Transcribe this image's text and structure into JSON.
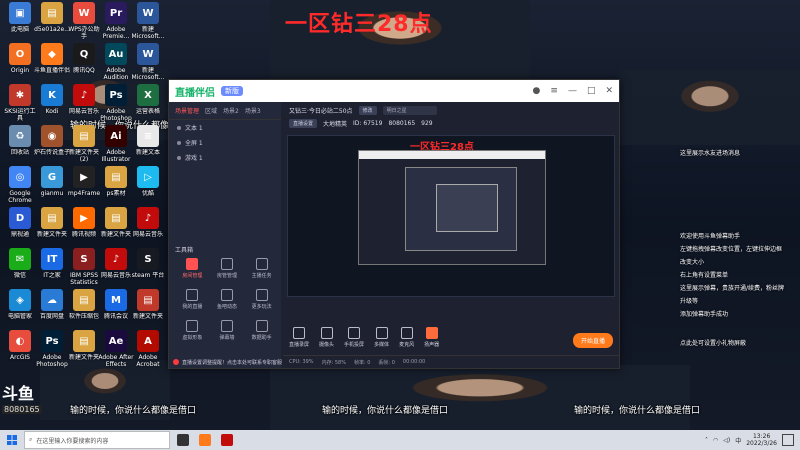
{
  "overlay_title": "一区钻三28点",
  "subtitles": [
    "输的时候，你说什么都像是借口",
    "输的时候，你说什么都像是借口",
    "输的时候，你说什么都像是借口"
  ],
  "desktop_icons": [
    {
      "label": "此电脑",
      "icon": "computer-icon",
      "color": "#3a7bd5",
      "glyph": "▣"
    },
    {
      "label": "d5e01a2e...",
      "icon": "folder-icon",
      "color": "#d9a441",
      "glyph": "▤"
    },
    {
      "label": "WPS办公助手",
      "icon": "wps-icon",
      "color": "#e94b3c",
      "glyph": "W"
    },
    {
      "label": "Adobe Premie...",
      "icon": "premiere-icon",
      "color": "#2a1a5e",
      "glyph": "Pr"
    },
    {
      "label": "新建Microsoft...",
      "icon": "doc-icon",
      "color": "#2b579a",
      "glyph": "W"
    },
    {
      "label": "Origin",
      "icon": "origin-icon",
      "color": "#f36f21",
      "glyph": "O"
    },
    {
      "label": "斗鱼直播伴侣",
      "icon": "douyu-icon",
      "color": "#ff7a1a",
      "glyph": "◆"
    },
    {
      "label": "腾讯QQ",
      "icon": "qq-icon",
      "color": "#1a1a1a",
      "glyph": "Q"
    },
    {
      "label": "Adobe Audition",
      "icon": "audition-icon",
      "color": "#00485a",
      "glyph": "Au"
    },
    {
      "label": "新建Microsoft...",
      "icon": "doc-icon",
      "color": "#2b579a",
      "glyph": "W"
    },
    {
      "label": "SKSI运行工具",
      "icon": "tool-icon",
      "color": "#c0392b",
      "glyph": "✱"
    },
    {
      "label": "Kodi",
      "icon": "kodi-icon",
      "color": "#1a7bd5",
      "glyph": "K"
    },
    {
      "label": "网易云音乐",
      "icon": "music-icon",
      "color": "#c20c0c",
      "glyph": "♪"
    },
    {
      "label": "Adobe Photoshop",
      "icon": "photoshop-icon",
      "color": "#001e36",
      "glyph": "Ps"
    },
    {
      "label": "运营表格",
      "icon": "excel-icon",
      "color": "#1d6f42",
      "glyph": "X"
    },
    {
      "label": "回收站",
      "icon": "recycle-icon",
      "color": "#6a8caf",
      "glyph": "♻"
    },
    {
      "label": "炉石传说盒子",
      "icon": "hearthstone-icon",
      "color": "#a0522d",
      "glyph": "◉"
    },
    {
      "label": "新建文件夹(2)",
      "icon": "folder-icon",
      "color": "#d9a441",
      "glyph": "▤"
    },
    {
      "label": "Adobe Illustrator",
      "icon": "illustrator-icon",
      "color": "#330000",
      "glyph": "Ai"
    },
    {
      "label": "新建文本",
      "icon": "text-icon",
      "color": "#e8e8e8",
      "glyph": "≡"
    },
    {
      "label": "Google Chrome",
      "icon": "chrome-icon",
      "color": "#4285f4",
      "glyph": "◎"
    },
    {
      "label": "gianmu",
      "icon": "app-icon",
      "color": "#3a9ad9",
      "glyph": "G"
    },
    {
      "label": "mp4Frame",
      "icon": "video-icon",
      "color": "#222",
      "glyph": "▶"
    },
    {
      "label": "ps素材",
      "icon": "folder-icon",
      "color": "#d9a441",
      "glyph": "▤"
    },
    {
      "label": "优酷",
      "icon": "youku-icon",
      "color": "#1ebbf0",
      "glyph": "▷"
    },
    {
      "label": "鼎视通",
      "icon": "app-icon",
      "color": "#2a5bd5",
      "glyph": "D"
    },
    {
      "label": "新建文件夹",
      "icon": "folder-icon",
      "color": "#d9a441",
      "glyph": "▤"
    },
    {
      "label": "腾讯视频",
      "icon": "tencent-video-icon",
      "color": "#ff6a00",
      "glyph": "▶"
    },
    {
      "label": "新建文件夹",
      "icon": "folder-icon",
      "color": "#d9a441",
      "glyph": "▤"
    },
    {
      "label": "网易云音乐",
      "icon": "music-icon",
      "color": "#c20c0c",
      "glyph": "♪"
    },
    {
      "label": "微信",
      "icon": "wechat-icon",
      "color": "#1aad19",
      "glyph": "✉"
    },
    {
      "label": "IT之家",
      "icon": "ithome-icon",
      "color": "#1a6ae6",
      "glyph": "IT"
    },
    {
      "label": "IBM SPSS Statistics 26",
      "icon": "spss-icon",
      "color": "#8b1e1e",
      "glyph": "S"
    },
    {
      "label": "网易云音乐",
      "icon": "music-icon",
      "color": "#c20c0c",
      "glyph": "♪"
    },
    {
      "label": "steam 平台",
      "icon": "steam-icon",
      "color": "#171a21",
      "glyph": "S"
    },
    {
      "label": "电脑管家",
      "icon": "security-icon",
      "color": "#1a8ad5",
      "glyph": "◈"
    },
    {
      "label": "百度网盘",
      "icon": "baidu-icon",
      "color": "#2a7bd5",
      "glyph": "☁"
    },
    {
      "label": "软件压缩包",
      "icon": "folder-icon",
      "color": "#d9a441",
      "glyph": "▤"
    },
    {
      "label": "腾讯会议",
      "icon": "meeting-icon",
      "color": "#1a6ae6",
      "glyph": "M"
    },
    {
      "label": "新建文件夹",
      "icon": "folder-icon",
      "color": "#c0392b",
      "glyph": "▤"
    },
    {
      "label": "ArcGIS",
      "icon": "arcgis-icon",
      "color": "#e74c3c",
      "glyph": "◐"
    },
    {
      "label": "Adobe Photoshop",
      "icon": "photoshop-icon",
      "color": "#001e36",
      "glyph": "Ps"
    },
    {
      "label": "新建文件夹",
      "icon": "folder-icon",
      "color": "#d9a441",
      "glyph": "▤"
    },
    {
      "label": "Adobe After Effects",
      "icon": "aftereffects-icon",
      "color": "#1a0a3e",
      "glyph": "Ae"
    },
    {
      "label": "Adobe Acrobat",
      "icon": "acrobat-icon",
      "color": "#b30b00",
      "glyph": "A"
    }
  ],
  "window": {
    "app_name": "直播伴侣",
    "version_badge": "新版",
    "tabs": [
      "场景管理",
      "区域",
      "场景2",
      "场景3"
    ],
    "scenes": [
      "文本 1",
      "全屏 1",
      "游戏 1"
    ],
    "tools_heading": "工具箱",
    "tools": [
      {
        "label": "房间管理",
        "icon": "room-icon",
        "hot": true
      },
      {
        "label": "房管管理",
        "icon": "admin-icon",
        "hot": false
      },
      {
        "label": "主播任务",
        "icon": "task-icon",
        "hot": false
      },
      {
        "label": "我的直播",
        "icon": "live-icon",
        "hot": false
      },
      {
        "label": "鱼吧动态",
        "icon": "feed-icon",
        "hot": false
      },
      {
        "label": "更多玩法",
        "icon": "more-icon",
        "hot": false
      },
      {
        "label": "虚拟形象",
        "icon": "avatar-icon",
        "hot": false
      },
      {
        "label": "弹幕墙",
        "icon": "danmu-icon",
        "hot": false
      },
      {
        "label": "数据助手",
        "icon": "data-icon",
        "hot": false
      }
    ],
    "stream_title": "又钻三·今日必站二50点",
    "title_chip": "修改",
    "title_input": "明日之星",
    "meta": [
      "直播设置",
      "大地精英",
      "ID: 67519",
      "8080165",
      "929"
    ],
    "preview_title": "一区钻三28点",
    "controls": [
      {
        "label": "直播录屏",
        "icon": "screen-icon"
      },
      {
        "label": "摄像头",
        "icon": "camera-icon"
      },
      {
        "label": "手机投屏",
        "icon": "phone-icon"
      },
      {
        "label": "多媒体",
        "icon": "media-icon"
      },
      {
        "label": "麦克风",
        "icon": "mic-icon"
      },
      {
        "label": "扬声器",
        "icon": "speaker-icon",
        "hot": true
      }
    ],
    "go_live": "开始直播",
    "bottom_note": "直播设置调整提醒！点击本处可联系专职客服",
    "status": [
      "CPU: 39%",
      "内存: 58%",
      "帧率: 0",
      "丢帧: 0",
      "00:00:00"
    ]
  },
  "right_panel": [
    "这里展示水友进场消息",
    "欢迎使用斗鱼弹幕助手",
    "左键拖拽弹幕改变位置，左键拉伸边框",
    "改变大小",
    "右上角有设置菜单",
    "这里展示弹幕，贵族开通/续费，粉丝牌",
    "升级等",
    "添加弹幕助手成功",
    "点此处可设置小礼物屏蔽"
  ],
  "streamer_logo": {
    "text": "斗鱼",
    "room_id": "8080165"
  },
  "taskbar": {
    "search_placeholder": "在这里输入你要搜索的内容",
    "time": "13:26",
    "date": "2022/3/26",
    "ime": "中",
    "apps": [
      {
        "icon": "task-view-icon",
        "color": "#333"
      },
      {
        "icon": "douyu-icon",
        "color": "#ff7a1a"
      },
      {
        "icon": "music-icon",
        "color": "#c20c0c"
      }
    ]
  }
}
